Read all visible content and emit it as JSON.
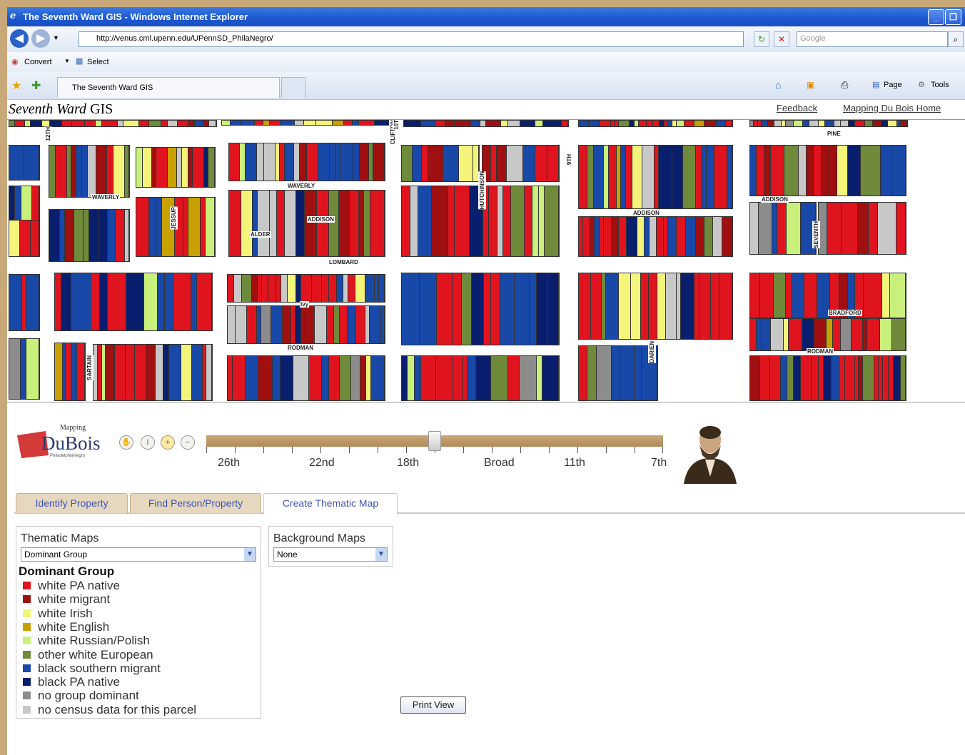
{
  "window": {
    "title": "The Seventh Ward GIS - Windows Internet Explorer"
  },
  "address_bar": {
    "url": "http://venus.cml.upenn.edu/UPennSD_PhilaNegro/",
    "search_placeholder": "Google"
  },
  "command_bar": {
    "convert_label": "Convert",
    "select_label": "Select"
  },
  "tab_bar": {
    "tab_title": "The Seventh Ward GIS",
    "page_label": "Page",
    "tools_label": "Tools"
  },
  "app": {
    "title_italic": "Seventh Ward",
    "title_rest": " GIS",
    "links": {
      "feedback": "Feedback",
      "home": "Mapping Du Bois Home"
    }
  },
  "map": {
    "street_labels": [
      "PINE",
      "WAVERLY",
      "WAVERLY",
      "ADDISON",
      "ADDISON",
      "ADDISON",
      "LOMBARD",
      "RODMAN",
      "RODMAN",
      "BRADFORD",
      "Ivy",
      "ALDER",
      "HUTCHINSON",
      "JESSUP",
      "CLIFTON",
      "DARIEN",
      "9TH",
      "12TH",
      "10T",
      "SARTAIN",
      "SEVENTH"
    ]
  },
  "logo": {
    "top": "Mapping",
    "main": "DuBois",
    "sub": "PhiladelphiaNegro"
  },
  "slider": {
    "labels": [
      "26th",
      "22nd",
      "18th",
      "Broad",
      "11th",
      "7th"
    ],
    "position": 0.49
  },
  "tabs": [
    {
      "label": "Identify Property",
      "active": false
    },
    {
      "label": "Find Person/Property",
      "active": false
    },
    {
      "label": "Create Thematic Map",
      "active": true
    }
  ],
  "thematic": {
    "label": "Thematic Maps",
    "selected": "Dominant Group"
  },
  "background": {
    "label": "Background Maps",
    "selected": "None"
  },
  "legend": {
    "title": "Dominant Group",
    "items": [
      {
        "label": "white PA native",
        "color": "#e0141e"
      },
      {
        "label": "white migrant",
        "color": "#a01010"
      },
      {
        "label": "white Irish",
        "color": "#f4f47a"
      },
      {
        "label": "white English",
        "color": "#c8a000"
      },
      {
        "label": "white Russian/Polish",
        "color": "#c8f07a"
      },
      {
        "label": "other white European",
        "color": "#6e8a3a"
      },
      {
        "label": "black southern migrant",
        "color": "#1848a8"
      },
      {
        "label": "black PA native",
        "color": "#0a1e6e"
      },
      {
        "label": "no group dominant",
        "color": "#8c8c8c"
      },
      {
        "label": "no census data for this parcel",
        "color": "#c8c8c8"
      }
    ]
  },
  "print_button": "Print View"
}
